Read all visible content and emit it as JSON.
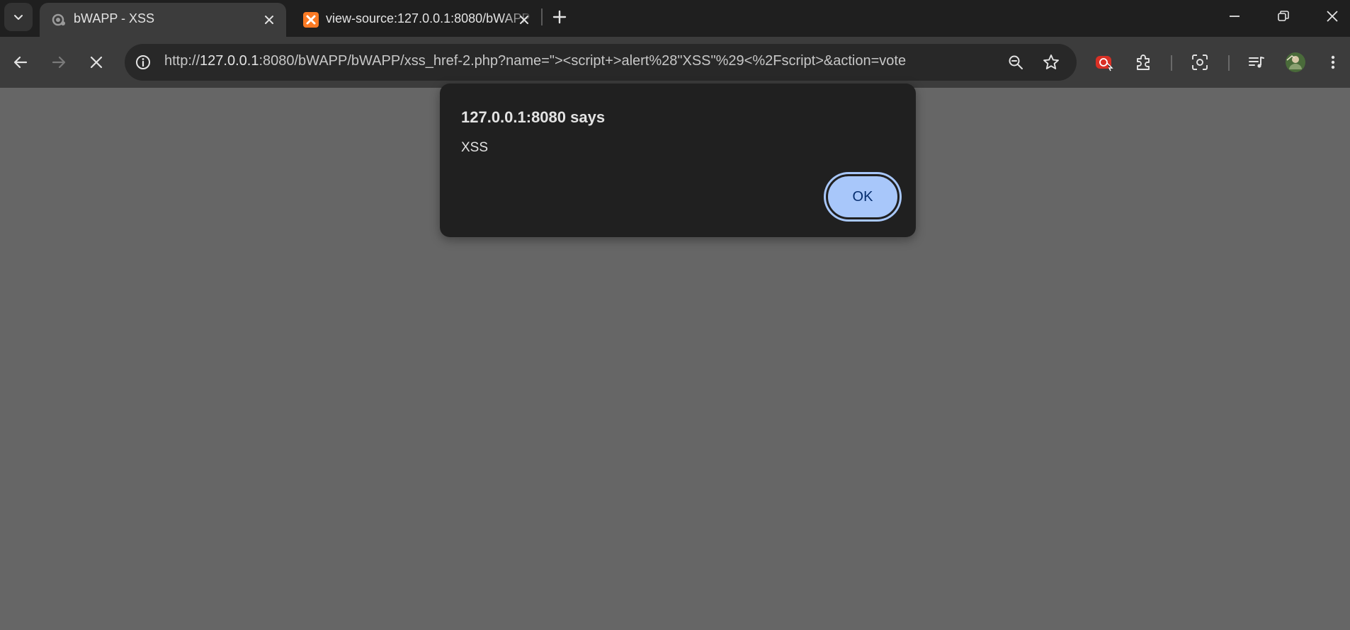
{
  "browser": {
    "tabs": [
      {
        "title": "bWAPP - XSS",
        "active": true,
        "icon": "loading-favicon-icon"
      },
      {
        "title": "view-source:127.0.0.1:8080/bWAPP",
        "active": false,
        "icon": "xampp-favicon-icon"
      }
    ],
    "address_bar": {
      "url_prefix": "http://",
      "url_host": "127.0.0.1",
      "url_rest": ":8080/bWAPP/bWAPP/xss_href-2.php?name=\"><script+>alert%28\"XSS\"%29<%2Fscript>&action=vote"
    },
    "colors": {
      "tabstrip": "#1f1f1f",
      "toolbar": "#3c3c3c",
      "page_overlay": "#666666",
      "dialog": "#202020",
      "accent": "#a8c7fa"
    }
  },
  "dialog": {
    "heading": "127.0.0.1:8080 says",
    "message": "XSS",
    "ok_label": "OK"
  }
}
